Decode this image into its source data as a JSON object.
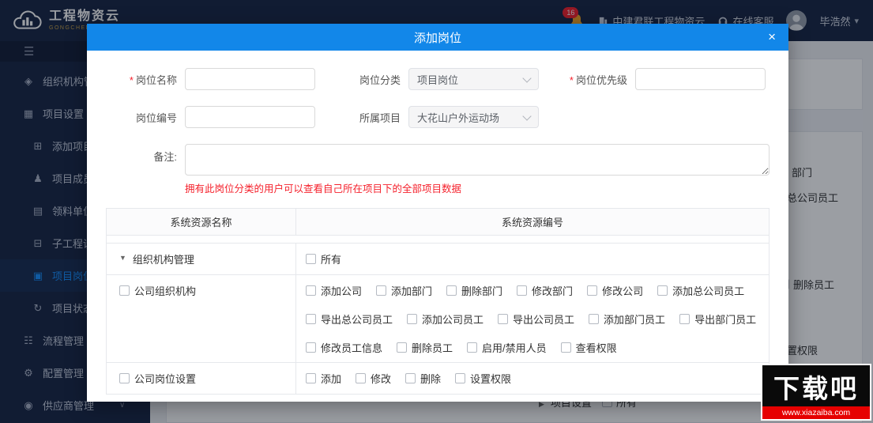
{
  "header": {
    "logo_title": "工程物资云",
    "logo_subtitle": "GONGCHENGWUZIYUN",
    "notification_badge": "16",
    "brand_text": "中建君联工程物资云",
    "online_service_label": "在线客服",
    "username": "毕浩然"
  },
  "sidebar": {
    "items": [
      {
        "label": "组织机构管理",
        "icon": "◈"
      },
      {
        "label": "项目设置",
        "icon": "▦"
      },
      {
        "label": "添加项目",
        "icon": "⊞"
      },
      {
        "label": "项目成员设置",
        "icon": "♟"
      },
      {
        "label": "领料单位设置",
        "icon": "▤"
      },
      {
        "label": "子工程设置",
        "icon": "⊟"
      },
      {
        "label": "项目岗位设置",
        "icon": "▣"
      },
      {
        "label": "项目状态管理",
        "icon": "↻"
      },
      {
        "label": "流程管理",
        "icon": "☷"
      },
      {
        "label": "配置管理",
        "icon": "⚙"
      },
      {
        "label": "供应商管理",
        "icon": "◉"
      }
    ]
  },
  "modal": {
    "title": "添加岗位",
    "close_label": "×",
    "form": {
      "required_mark": "*",
      "name_label": "岗位名称",
      "category_label": "岗位分类",
      "category_value": "项目岗位",
      "priority_label": "岗位优先级",
      "code_label": "岗位编号",
      "project_label": "所属项目",
      "project_value": "大花山户外运动场",
      "remark_label": "备注:",
      "hint": "拥有此岗位分类的用户可以查看自己所在项目下的全部项目数据"
    },
    "table": {
      "headers": [
        "系统资源名称",
        "系统资源编号"
      ],
      "rows": [
        {
          "name": "组织机构管理",
          "perm_lines": [
            [
              "所有"
            ]
          ]
        },
        {
          "name": "公司组织机构",
          "perm_lines": [
            [
              "添加公司",
              "添加部门",
              "删除部门",
              "修改部门",
              "修改公司",
              "添加总公司员工"
            ],
            [
              "导出总公司员工",
              "添加公司员工",
              "导出公司员工",
              "添加部门员工",
              "导出部门员工"
            ],
            [
              "修改员工信息",
              "删除员工",
              "启用/禁用人员",
              "查看权限"
            ]
          ]
        },
        {
          "name": "公司岗位设置",
          "perm_lines": [
            [
              "添加",
              "修改",
              "删除",
              "设置权限"
            ]
          ]
        }
      ]
    }
  },
  "background": {
    "fragments": {
      "f1": "部门",
      "f2": "总公司员工",
      "f3": "删除员工",
      "f4": "置权限",
      "group_label": "项目设置",
      "group_perm": "所有"
    }
  },
  "watermark": {
    "title": "下载吧",
    "url": "www.xiazaiba.com"
  },
  "colors": {
    "accent": "#1287e9",
    "danger": "#f5222d",
    "navy": "#1a2745"
  }
}
